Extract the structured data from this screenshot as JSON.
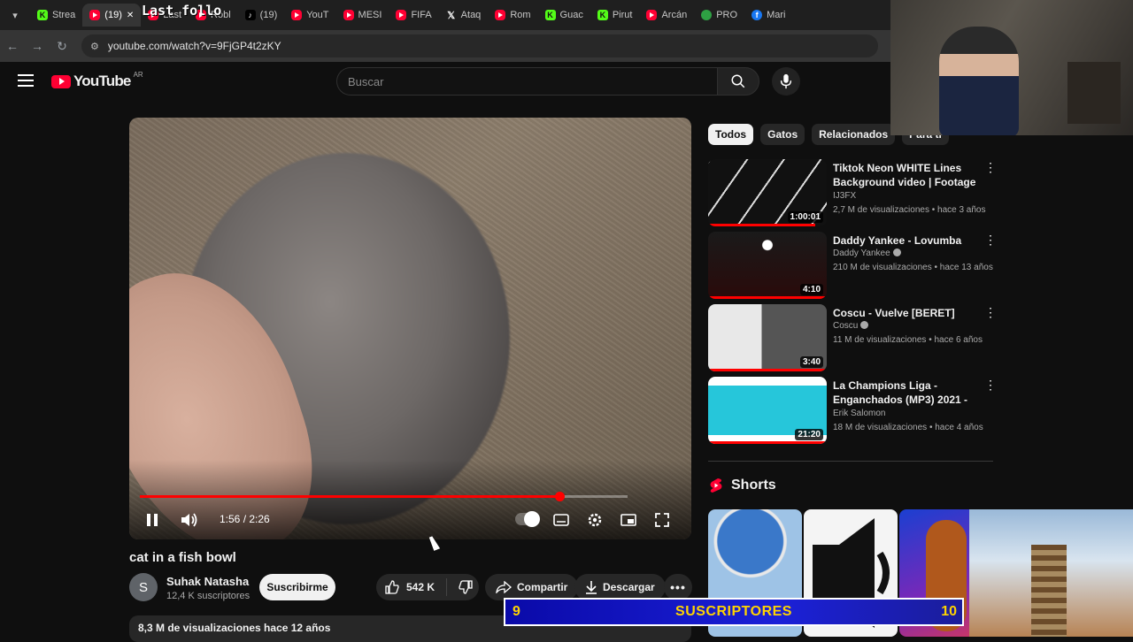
{
  "browser": {
    "tabs": [
      {
        "label": "Strea",
        "icon": "kick"
      },
      {
        "label": "(19)",
        "icon": "youtube",
        "active": true
      },
      {
        "label": "Last",
        "icon": "youtube"
      },
      {
        "label": "Robl",
        "icon": "youtube"
      },
      {
        "label": "(19)",
        "icon": "tiktok"
      },
      {
        "label": "YouT",
        "icon": "youtube"
      },
      {
        "label": "MESI",
        "icon": "youtube"
      },
      {
        "label": "FIFA",
        "icon": "youtube"
      },
      {
        "label": "Ataq",
        "icon": "x"
      },
      {
        "label": "Rom",
        "icon": "youtube"
      },
      {
        "label": "Guac",
        "icon": "kick"
      },
      {
        "label": "Pirut",
        "icon": "kick"
      },
      {
        "label": "Arcán",
        "icon": "youtube"
      },
      {
        "label": "PRO",
        "icon": "generic"
      },
      {
        "label": "Mari",
        "icon": "facebook"
      }
    ],
    "url": "youtube.com/watch?v=9FjGP4t2zKY"
  },
  "stream_overlay": {
    "banner_text": "Last follo",
    "sub_goal": {
      "current": "9",
      "label": "SUSCRIPTORES",
      "target": "10"
    }
  },
  "youtube": {
    "logo_text": "YouTube",
    "country_code": "AR",
    "search": {
      "placeholder": "Buscar"
    },
    "player": {
      "time": "1:56 / 2:26",
      "progress": 0.86
    },
    "video": {
      "title": "cat in a fish bowl",
      "channel": "Suhak Natasha",
      "channel_initial": "S",
      "subscribers": "12,4 K suscriptores",
      "subscribe_label": "Suscribirme",
      "likes": "542 K",
      "share_label": "Compartir",
      "download_label": "Descargar",
      "views_date": "8,3 M de visualizaciones  hace 12 años"
    },
    "chips": [
      "Todos",
      "Gatos",
      "Relacionados",
      "Para ti"
    ],
    "recommendations": [
      {
        "title": "Tiktok Neon WHITE Lines Background video | Footage | ...",
        "channel": "IJ3FX",
        "verified": false,
        "meta": "2,7 M de visualizaciones • hace 3 años",
        "duration": "1:00:01",
        "watched": 0.9
      },
      {
        "title": "Daddy Yankee - Lovumba",
        "channel": "Daddy Yankee",
        "verified": true,
        "meta": "210 M de visualizaciones • hace 13 años",
        "duration": "4:10",
        "watched": 1.0
      },
      {
        "title": "Coscu - Vuelve [BERET]",
        "channel": "Coscu",
        "verified": true,
        "meta": "11 M de visualizaciones • hace 6 años",
        "duration": "3:40",
        "watched": 1.0
      },
      {
        "title": "La Champions Liga - Enganchados (MP3) 2021 - ...",
        "channel": "Erik Salomon",
        "verified": false,
        "meta": "18 M de visualizaciones • hace 4 años",
        "duration": "21:20",
        "watched": 1.0
      }
    ],
    "shorts_label": "Shorts",
    "colors": {
      "accent": "#ff0033",
      "bg": "#0f0f0f"
    }
  }
}
